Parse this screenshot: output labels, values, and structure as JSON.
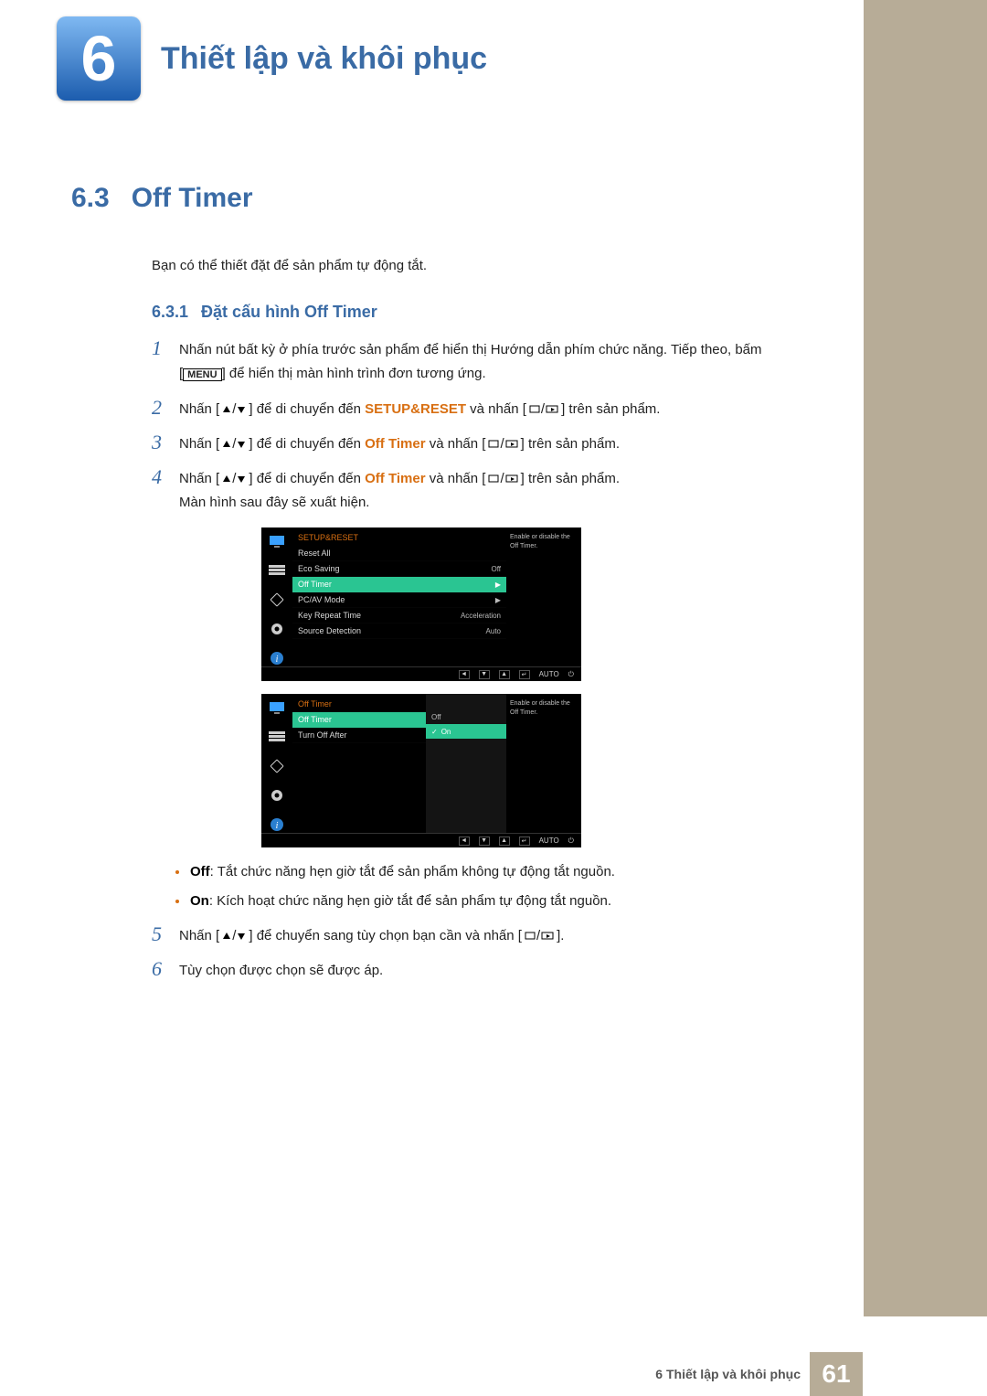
{
  "chapter": {
    "num": "6",
    "title": "Thiết lập và khôi phục"
  },
  "section": {
    "num": "6.3",
    "title": "Off Timer"
  },
  "lead": "Bạn có thể thiết đặt để sản phẩm tự động tắt.",
  "subsection": {
    "num": "6.3.1",
    "title": "Đặt cấu hình Off Timer"
  },
  "steps": {
    "s1a": "Nhấn nút bất kỳ ở phía trước sản phẩm để hiển thị Hướng dẫn phím chức năng. Tiếp theo, bấm [",
    "s1_menu": "MENU",
    "s1b": "] để hiển thị màn hình trình đơn tương ứng.",
    "s2a": "Nhấn [",
    "s2b": "] để di chuyển đến ",
    "s2_target": "SETUP&RESET",
    "s2c": " và nhấn [",
    "s2d": "] trên sản phẩm.",
    "s3a": "Nhấn [",
    "s3b": "] để di chuyển đến ",
    "s3_target": "Off Timer",
    "s3c": " và nhấn [",
    "s3d": "] trên sản phẩm.",
    "s4a": "Nhấn [",
    "s4b": "] để di chuyển đến ",
    "s4_target": "Off Timer",
    "s4c": " và nhấn [",
    "s4d": "] trên sản phẩm.",
    "s4_after": "Màn hình sau đây sẽ xuất hiện.",
    "s5a": "Nhấn [",
    "s5b": "] để chuyển sang tùy chọn bạn cần và nhấn [",
    "s5c": "].",
    "s6": "Tùy chọn được chọn sẽ được áp."
  },
  "bullets": {
    "off_lbl": "Off",
    "off_txt": ": Tắt chức năng hẹn giờ tắt để sản phẩm không tự động tắt nguồn.",
    "on_lbl": "On",
    "on_txt": ": Kích hoạt chức năng hẹn giờ tắt để sản phẩm tự động tắt nguồn."
  },
  "osd1": {
    "title": "SETUP&RESET",
    "desc": "Enable or disable the Off Timer.",
    "rows": [
      {
        "lbl": "Reset All",
        "val": ""
      },
      {
        "lbl": "Eco Saving",
        "val": "Off"
      },
      {
        "lbl": "Off Timer",
        "val": "▶",
        "sel": true
      },
      {
        "lbl": "PC/AV Mode",
        "val": "▶"
      },
      {
        "lbl": "Key Repeat Time",
        "val": "Acceleration"
      },
      {
        "lbl": "Source Detection",
        "val": "Auto"
      }
    ],
    "bottom_auto": "AUTO"
  },
  "osd2": {
    "title": "Off Timer",
    "desc": "Enable or disable the Off Timer.",
    "rows": [
      {
        "lbl": "Off Timer",
        "val": "Off",
        "sel": true
      },
      {
        "lbl": "Turn Off After",
        "val": ""
      }
    ],
    "sub": [
      {
        "lbl": "Off"
      },
      {
        "lbl": "On",
        "sel": true
      }
    ],
    "bottom_auto": "AUTO"
  },
  "footer": {
    "text": "6 Thiết lập và khôi phục",
    "page": "61"
  }
}
